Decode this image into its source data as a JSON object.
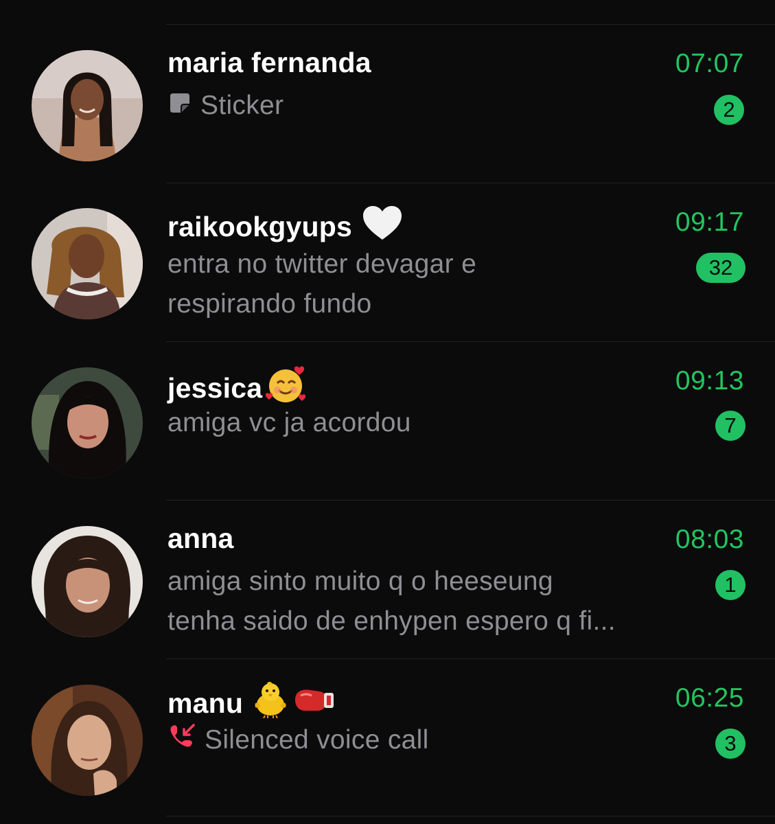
{
  "chats": [
    {
      "name": "maria fernanda",
      "time": "07:07",
      "unread": "2",
      "preview_icon": "sticker-icon",
      "preview_lines": [
        "Sticker"
      ]
    },
    {
      "name": "raikookgyups",
      "name_emoji": "white-heart",
      "time": "09:17",
      "unread": "32",
      "preview_lines": [
        "entra no twitter devagar e",
        "respirando fundo"
      ]
    },
    {
      "name": "jessica",
      "name_emoji": "smiling-face-with-hearts",
      "time": "09:13",
      "unread": "7",
      "preview_lines": [
        "amiga vc ja acordou"
      ]
    },
    {
      "name": "anna",
      "time": "08:03",
      "unread": "1",
      "preview_lines": [
        "amiga sinto muito q o heeseung",
        "tenha saido de enhypen espero q fi..."
      ]
    },
    {
      "name": "manu",
      "name_emoji": "baby-chick, boxing-glove",
      "time": "06:25",
      "unread": "3",
      "preview_icon": "missed-call-icon",
      "preview_lines": [
        "Silenced voice call"
      ]
    }
  ],
  "colors": {
    "background": "#0b0b0c",
    "accent_green": "#22c55e",
    "badge_green": "#21c063",
    "preview_gray": "#8e8e93",
    "missed_call_red": "#ff3b5c"
  }
}
